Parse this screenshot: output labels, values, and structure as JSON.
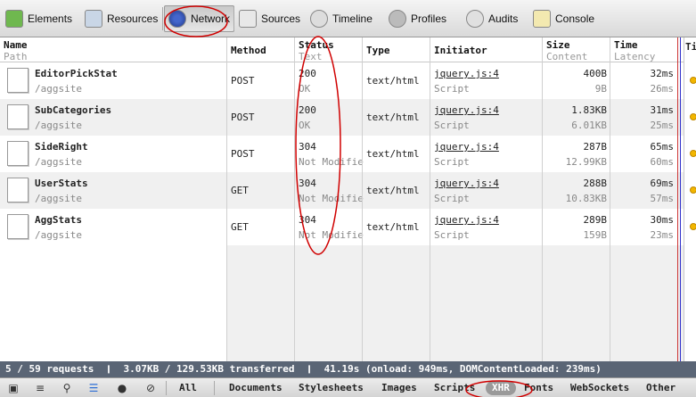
{
  "toolbar": {
    "items": [
      {
        "label": "Elements",
        "icon": "elements-icon"
      },
      {
        "label": "Resources",
        "icon": "resources-icon"
      },
      {
        "label": "Network",
        "icon": "network-icon"
      },
      {
        "label": "Sources",
        "icon": "sources-icon"
      },
      {
        "label": "Timeline",
        "icon": "timeline-icon"
      },
      {
        "label": "Profiles",
        "icon": "profiles-icon"
      },
      {
        "label": "Audits",
        "icon": "audits-icon"
      },
      {
        "label": "Console",
        "icon": "console-icon"
      }
    ]
  },
  "columns": {
    "name": {
      "title": "Name",
      "sub": "Path"
    },
    "method": {
      "title": "Method"
    },
    "status": {
      "title": "Status",
      "sub": "Text"
    },
    "type": {
      "title": "Type"
    },
    "initiator": {
      "title": "Initiator"
    },
    "size": {
      "title": "Size",
      "sub": "Content"
    },
    "time": {
      "title": "Time",
      "sub": "Latency"
    },
    "timeline": {
      "title": "Ti"
    }
  },
  "rows": [
    {
      "name": "EditorPickStat",
      "path": "/aggsite",
      "method": "POST",
      "status": "200",
      "status_text": "OK",
      "type": "text/html",
      "initiator": "jquery.js:4",
      "initiator_type": "Script",
      "size": "400B",
      "content": "9B",
      "time": "32ms",
      "latency": "26ms"
    },
    {
      "name": "SubCategories",
      "path": "/aggsite",
      "method": "POST",
      "status": "200",
      "status_text": "OK",
      "type": "text/html",
      "initiator": "jquery.js:4",
      "initiator_type": "Script",
      "size": "1.83KB",
      "content": "6.01KB",
      "time": "31ms",
      "latency": "25ms"
    },
    {
      "name": "SideRight",
      "path": "/aggsite",
      "method": "POST",
      "status": "304",
      "status_text": "Not Modifie",
      "type": "text/html",
      "initiator": "jquery.js:4",
      "initiator_type": "Script",
      "size": "287B",
      "content": "12.99KB",
      "time": "65ms",
      "latency": "60ms"
    },
    {
      "name": "UserStats",
      "path": "/aggsite",
      "method": "GET",
      "status": "304",
      "status_text": "Not Modifie",
      "type": "text/html",
      "initiator": "jquery.js:4",
      "initiator_type": "Script",
      "size": "288B",
      "content": "10.83KB",
      "time": "69ms",
      "latency": "57ms"
    },
    {
      "name": "AggStats",
      "path": "/aggsite",
      "method": "GET",
      "status": "304",
      "status_text": "Not Modifie",
      "type": "text/html",
      "initiator": "jquery.js:4",
      "initiator_type": "Script",
      "size": "289B",
      "content": "159B",
      "time": "30ms",
      "latency": "23ms"
    }
  ],
  "status_bar": "5 / 59 requests  ❙  3.07KB / 129.53KB transferred  ❙  41.19s (onload: 949ms, DOMContentLoaded: 239ms)",
  "bottom": {
    "icons": [
      "dock-icon",
      "console-drawer-icon",
      "search-icon",
      "list-view-icon",
      "record-icon",
      "clear-icon"
    ],
    "filters": [
      "All",
      "Documents",
      "Stylesheets",
      "Images",
      "Scripts",
      "XHR",
      "Fonts",
      "WebSockets",
      "Other"
    ],
    "selected_filter": "XHR"
  },
  "colors": {
    "status_bar": "#5a6575",
    "annotation": "#d00000",
    "timeline_dot": "#f2b600"
  }
}
